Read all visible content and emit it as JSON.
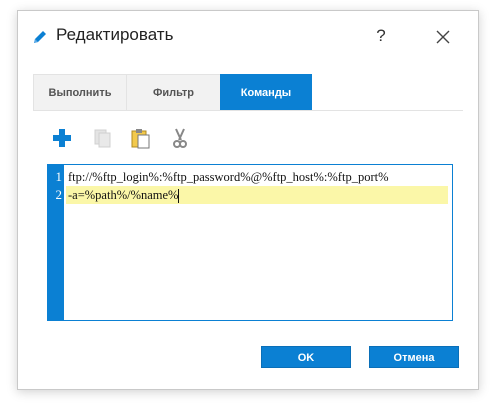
{
  "dialog": {
    "title": "Редактировать",
    "help_label": "?"
  },
  "tabs": [
    {
      "label": "Выполнить",
      "active": false
    },
    {
      "label": "Фильтр",
      "active": false
    },
    {
      "label": "Команды",
      "active": true
    }
  ],
  "toolbar": {
    "icons": [
      "add-icon",
      "copy-icon",
      "paste-icon",
      "cut-icon"
    ]
  },
  "editor": {
    "lines": [
      {
        "number": "1",
        "text": "ftp://%ftp_login%:%ftp_password%@%ftp_host%:%ftp_port%"
      },
      {
        "number": "2",
        "text": "-a=%path%/%name%"
      }
    ]
  },
  "buttons": {
    "ok_label": "OK",
    "cancel_label": "Отмена"
  },
  "colors": {
    "accent": "#0b80d3",
    "active_line": "#fbf7a8"
  }
}
